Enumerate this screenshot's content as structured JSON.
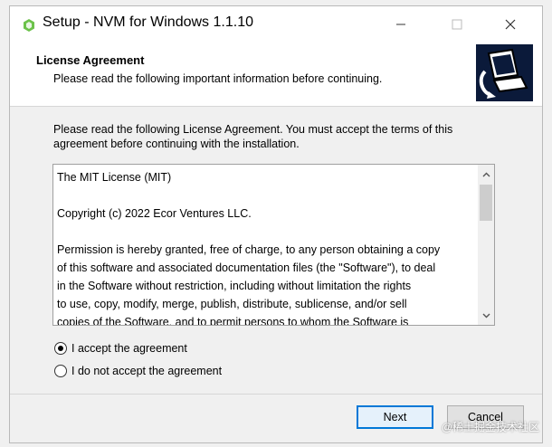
{
  "window": {
    "title": "Setup - NVM for Windows 1.1.10",
    "icon": "nvm-app-icon",
    "minimize_icon": "minimize-icon",
    "maximize_icon": "maximize-icon",
    "close_icon": "close-icon"
  },
  "header": {
    "title": "License Agreement",
    "subtitle": "Please read the following important information before continuing.",
    "image": "installer-computer-graphic"
  },
  "intro_text": "Please read the following License Agreement. You must accept the terms of this agreement before continuing with the installation.",
  "license": {
    "text": "The MIT License (MIT)\n\nCopyright (c) 2022 Ecor Ventures LLC.\n\nPermission is hereby granted, free of charge, to any person obtaining a copy\nof this software and associated documentation files (the \"Software\"), to deal\nin the Software without restriction, including without limitation the rights\nto use, copy, modify, merge, publish, distribute, sublicense, and/or sell\ncopies of the Software, and to permit persons to whom the Software is"
  },
  "options": {
    "accept": "I accept the agreement",
    "decline": "I do not accept the agreement",
    "selected": "accept"
  },
  "buttons": {
    "next": "Next",
    "cancel": "Cancel"
  },
  "watermark": "@稀土掘金技术社区",
  "colors": {
    "accent": "#0078d7",
    "header_bg": "#ffffff",
    "body_bg": "#f0f0f0"
  }
}
